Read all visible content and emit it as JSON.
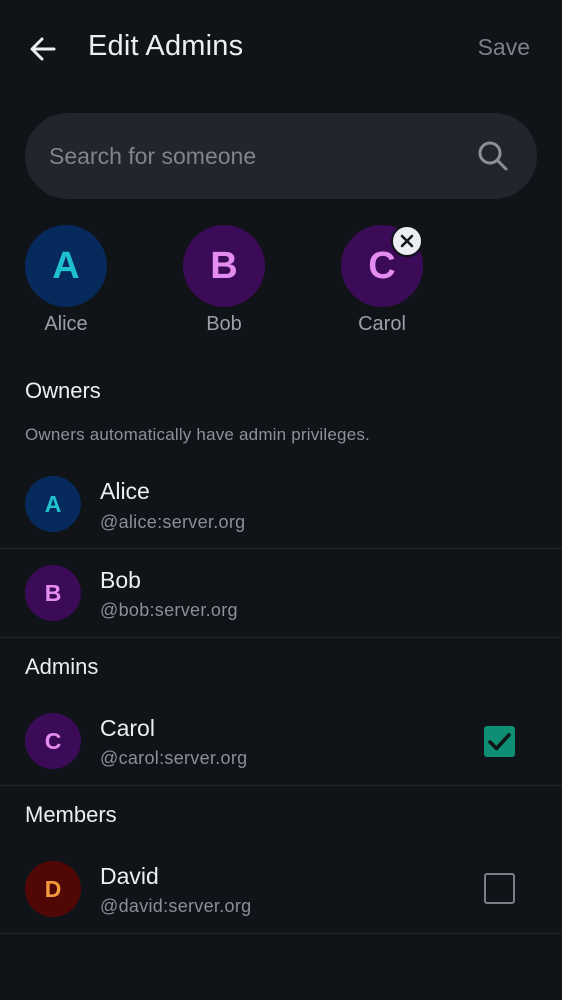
{
  "header": {
    "title": "Edit Admins",
    "save_label": "Save",
    "back_icon": "arrow-back-icon"
  },
  "search": {
    "placeholder": "Search for someone",
    "value": "",
    "icon": "search-icon"
  },
  "selected": [
    {
      "initial": "A",
      "name": "Alice",
      "removable": false
    },
    {
      "initial": "B",
      "name": "Bob",
      "removable": false
    },
    {
      "initial": "C",
      "name": "Carol",
      "removable": true
    }
  ],
  "sections": {
    "owners": {
      "title": "Owners",
      "description": "Owners automatically have admin privileges.",
      "users": [
        {
          "initial": "A",
          "name": "Alice",
          "handle": "@alice:server.org"
        },
        {
          "initial": "B",
          "name": "Bob",
          "handle": "@bob:server.org"
        }
      ]
    },
    "admins": {
      "title": "Admins",
      "users": [
        {
          "initial": "C",
          "name": "Carol",
          "handle": "@carol:server.org",
          "checked": true
        }
      ]
    },
    "members": {
      "title": "Members",
      "users": [
        {
          "initial": "D",
          "name": "David",
          "handle": "@david:server.org",
          "checked": false
        }
      ]
    }
  },
  "colors": {
    "background": "#101318",
    "accent_checkbox": "#0e8f74",
    "avatar_alice_bg": "#062a5c",
    "avatar_alice_fg": "#1fc1d0",
    "avatar_purple_bg": "#3b0b57",
    "avatar_purple_fg": "#e58cf0",
    "avatar_david_bg": "#520707",
    "avatar_david_fg": "#f39a3c"
  }
}
